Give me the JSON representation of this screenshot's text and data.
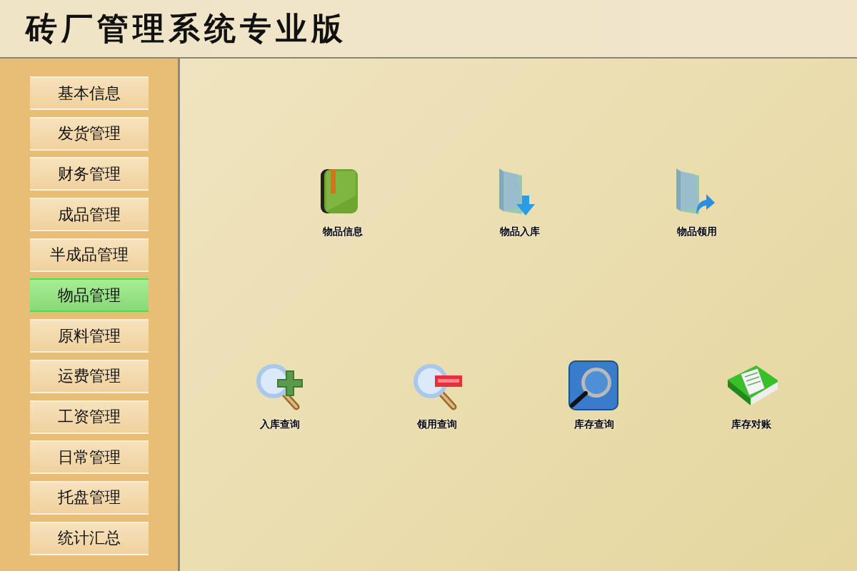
{
  "header": {
    "title": "砖厂管理系统专业版"
  },
  "sidebar": {
    "items": [
      {
        "label": "基本信息",
        "selected": false
      },
      {
        "label": "发货管理",
        "selected": false
      },
      {
        "label": "财务管理",
        "selected": false
      },
      {
        "label": "成品管理",
        "selected": false
      },
      {
        "label": "半成品管理",
        "selected": false
      },
      {
        "label": "物品管理",
        "selected": true
      },
      {
        "label": "原料管理",
        "selected": false
      },
      {
        "label": "运费管理",
        "selected": false
      },
      {
        "label": "工资管理",
        "selected": false
      },
      {
        "label": "日常管理",
        "selected": false
      },
      {
        "label": "托盘管理",
        "selected": false
      },
      {
        "label": "统计汇总",
        "selected": false
      }
    ]
  },
  "main": {
    "rows": [
      [
        {
          "label": "物品信息",
          "kind": "book"
        },
        {
          "label": "物品入库",
          "kind": "folder-down"
        },
        {
          "label": "物品领用",
          "kind": "folder-out"
        }
      ],
      [
        {
          "label": "入库查询",
          "kind": "magnifier-plus"
        },
        {
          "label": "领用查询",
          "kind": "magnifier-minus"
        },
        {
          "label": "库存查询",
          "kind": "magnifier-tile"
        },
        {
          "label": "库存对账",
          "kind": "ledger"
        }
      ]
    ]
  }
}
